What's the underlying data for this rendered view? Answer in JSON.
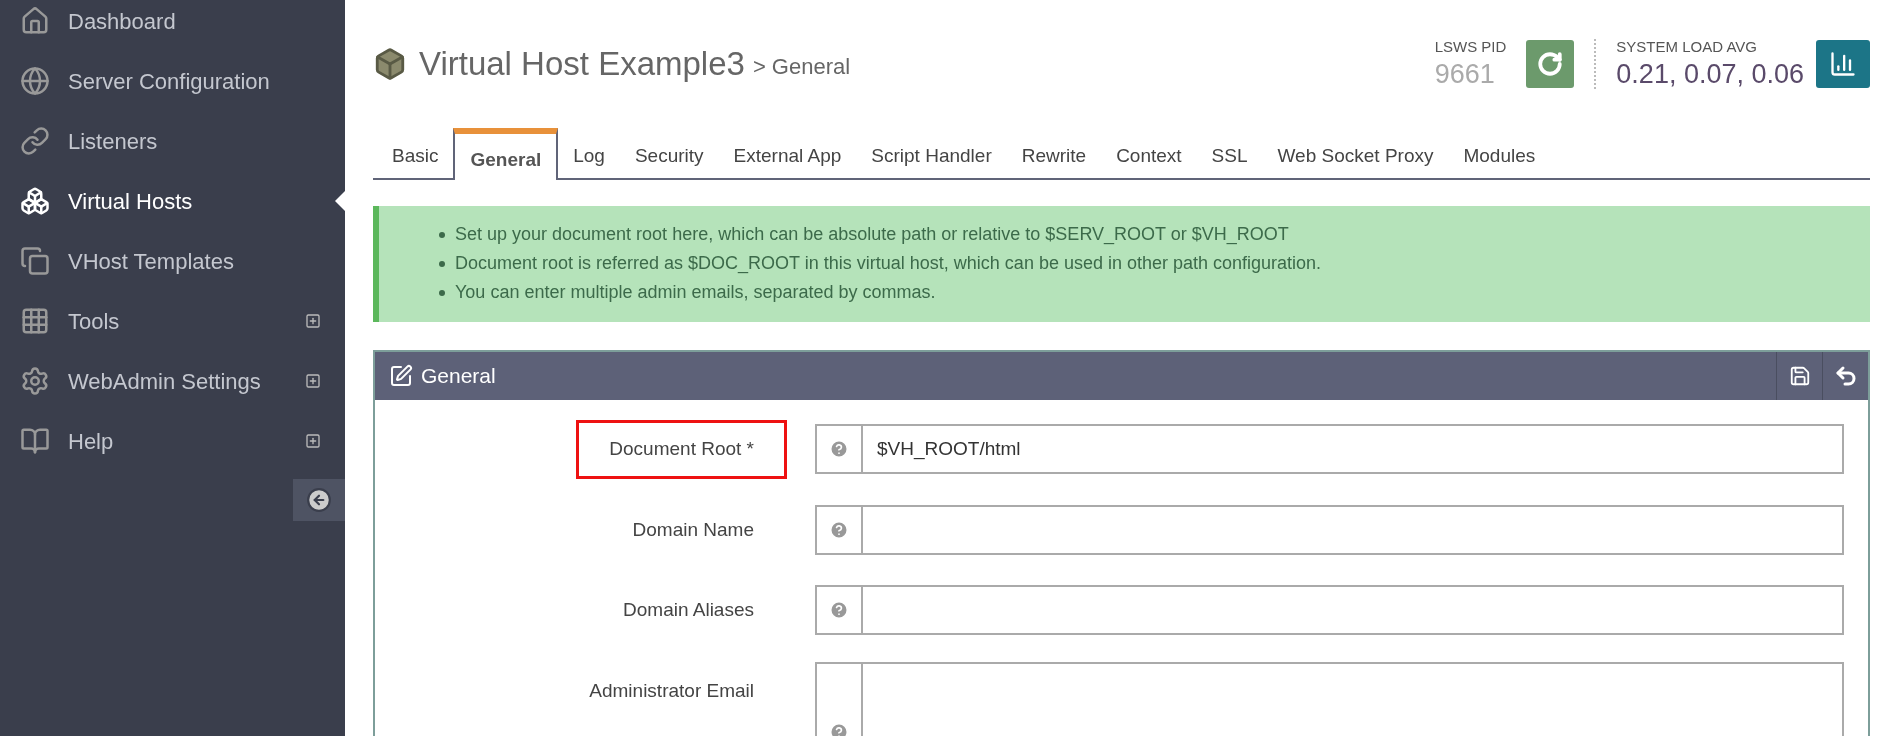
{
  "sidebar": {
    "items": [
      {
        "label": "Dashboard",
        "selected": false,
        "expandable": false
      },
      {
        "label": "Server Configuration",
        "selected": false,
        "expandable": false
      },
      {
        "label": "Listeners",
        "selected": false,
        "expandable": false
      },
      {
        "label": "Virtual Hosts",
        "selected": true,
        "expandable": false
      },
      {
        "label": "VHost Templates",
        "selected": false,
        "expandable": false
      },
      {
        "label": "Tools",
        "selected": false,
        "expandable": true
      },
      {
        "label": "WebAdmin Settings",
        "selected": false,
        "expandable": true
      },
      {
        "label": "Help",
        "selected": false,
        "expandable": true
      }
    ]
  },
  "header": {
    "title": "Virtual Host Example3",
    "subtitle": "> General",
    "pid_label": "LSWS PID",
    "pid": "9661",
    "load_label": "SYSTEM LOAD AVG",
    "load": "0.21, 0.07, 0.06"
  },
  "tabs": [
    {
      "label": "Basic",
      "selected": false
    },
    {
      "label": "General",
      "selected": true
    },
    {
      "label": "Log",
      "selected": false
    },
    {
      "label": "Security",
      "selected": false
    },
    {
      "label": "External App",
      "selected": false
    },
    {
      "label": "Script Handler",
      "selected": false
    },
    {
      "label": "Rewrite",
      "selected": false
    },
    {
      "label": "Context",
      "selected": false
    },
    {
      "label": "SSL",
      "selected": false
    },
    {
      "label": "Web Socket Proxy",
      "selected": false
    },
    {
      "label": "Modules",
      "selected": false
    }
  ],
  "notes": [
    "Set up your document root here, which can be absolute path or relative to $SERV_ROOT or $VH_ROOT",
    "Document root is referred as $DOC_ROOT in this virtual host, which can be used in other path configuration.",
    "You can enter multiple admin emails, separated by commas."
  ],
  "panel": {
    "title": "General",
    "fields": [
      {
        "label": "Document Root *",
        "kind": "input",
        "value": "$VH_ROOT/html",
        "highlighted": true
      },
      {
        "label": "Domain Name",
        "kind": "input",
        "highlighted": false
      },
      {
        "label": "Domain Aliases",
        "kind": "input",
        "highlighted": false
      },
      {
        "label": "Administrator Email",
        "kind": "textarea",
        "highlighted": false
      }
    ]
  }
}
